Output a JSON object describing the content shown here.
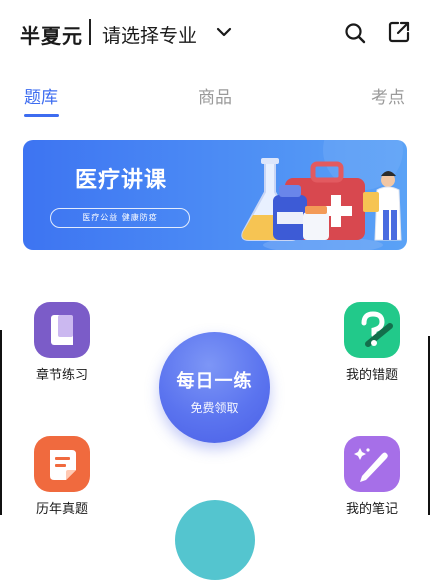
{
  "header": {
    "brand": "半夏元",
    "major_selector": "请选择专业"
  },
  "tabs": [
    {
      "label": "题库",
      "active": true
    },
    {
      "label": "商品",
      "active": false
    },
    {
      "label": "考点",
      "active": false
    }
  ],
  "banner": {
    "title": "医疗讲课",
    "subtitle": "医疗公益  健康防疫"
  },
  "menu": {
    "chapter": "章节练习",
    "mistakes": "我的错题",
    "past_exams": "历年真题",
    "notes": "我的笔记"
  },
  "daily": {
    "title": "每日一练",
    "subtitle": "免费领取"
  },
  "colors": {
    "accent": "#3d6cf0",
    "chapter": "#7b5cc8",
    "mistakes": "#22c98a",
    "past_exams": "#f06a3e",
    "notes": "#a66fe8"
  }
}
